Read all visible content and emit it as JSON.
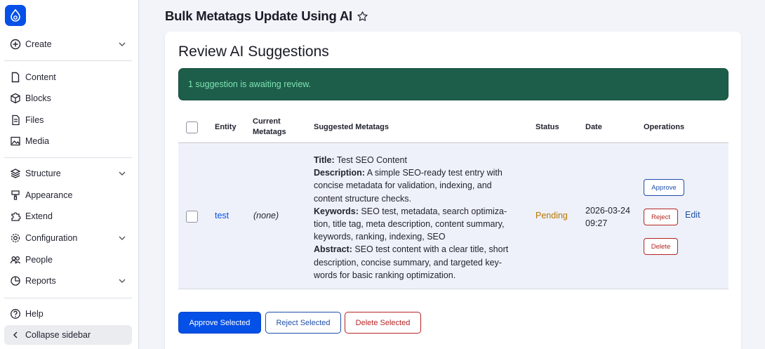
{
  "sidebar": {
    "items": [
      {
        "label": "Create",
        "icon": "plus-circle-icon"
      },
      {
        "label": "Content",
        "icon": "document-icon"
      },
      {
        "label": "Blocks",
        "icon": "cube-icon"
      },
      {
        "label": "Files",
        "icon": "files-icon"
      },
      {
        "label": "Media",
        "icon": "media-icon"
      },
      {
        "label": "Structure",
        "icon": "layers-icon"
      },
      {
        "label": "Appearance",
        "icon": "brush-icon"
      },
      {
        "label": "Extend",
        "icon": "puzzle-icon"
      },
      {
        "label": "Configuration",
        "icon": "gear-icon"
      },
      {
        "label": "People",
        "icon": "people-icon"
      },
      {
        "label": "Reports",
        "icon": "chart-icon"
      },
      {
        "label": "Help",
        "icon": "help-icon"
      },
      {
        "label": "Collapse sidebar",
        "icon": "chevron-left-icon"
      }
    ]
  },
  "header": {
    "title": "Bulk Metatags Update Using AI"
  },
  "card": {
    "title": "Review AI Suggestions",
    "alert": "1 suggestion is awaiting review."
  },
  "table": {
    "headers": {
      "entity": "Entity",
      "current_line1": "Current",
      "current_line2": "Metatags",
      "suggested": "Suggested Metatags",
      "status": "Status",
      "date": "Date",
      "operations": "Operations"
    },
    "rows": [
      {
        "entity": "test",
        "current": "(none)",
        "meta": {
          "title_label": "Title:",
          "title": "Test SEO Content",
          "description_label": "Description:",
          "description": "A simple SEO-ready test entry with concise metadata for validation, indexing, and content structure checks.",
          "keywords_label": "Keywords:",
          "keywords": "SEO test, metadata, search optimiza-tion, title tag, meta description, content summary, keywords, ranking, indexing, SEO",
          "abstract_label": "Abstract:",
          "abstract": "SEO test content with a clear title, short description, concise summary, and targeted key-words for basic ranking optimization."
        },
        "status": "Pending",
        "date": "2026-03-24 09:27",
        "ops": {
          "approve": "Approve",
          "reject": "Reject",
          "delete": "Delete",
          "edit": "Edit"
        }
      }
    ]
  },
  "actions": {
    "approve_selected": "Approve Selected",
    "reject_selected": "Reject Selected",
    "delete_selected": "Delete Selected"
  },
  "colors": {
    "primary": "#0550e6",
    "alert_bg": "#1d5e4a",
    "alert_text": "#7fe3b3",
    "danger": "#b52424",
    "pending": "#b87400"
  }
}
